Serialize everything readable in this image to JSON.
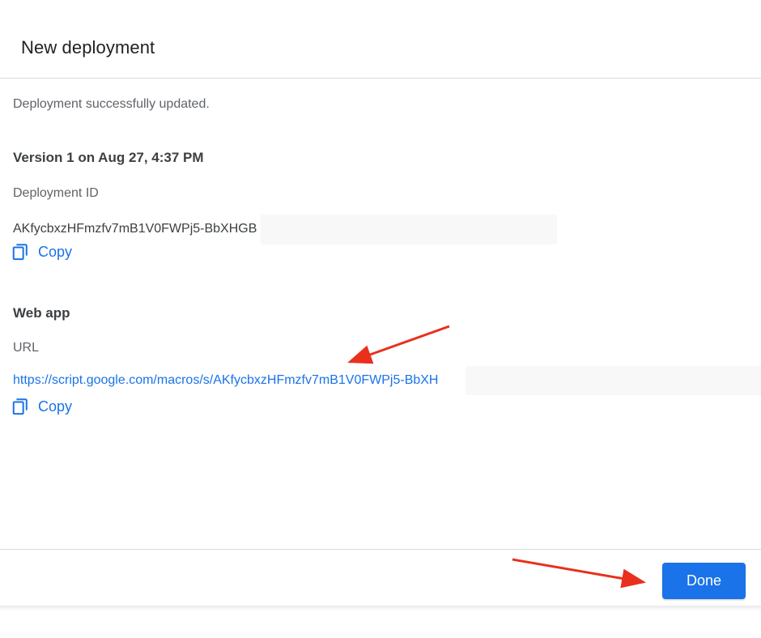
{
  "dialog": {
    "title": "New deployment",
    "status_message": "Deployment successfully updated."
  },
  "version": {
    "heading": "Version 1 on Aug 27, 4:37 PM"
  },
  "deployment_id": {
    "label": "Deployment ID",
    "value": "AKfycbxzHFmzfv7mB1V0FWPj5-BbXHGB",
    "copy_label": "Copy"
  },
  "web_app": {
    "heading": "Web app",
    "url_label": "URL",
    "url_value": "https://script.google.com/macros/s/AKfycbxzHFmzfv7mB1V0FWPj5-BbXH",
    "copy_label": "Copy"
  },
  "footer": {
    "done_label": "Done"
  },
  "colors": {
    "accent": "#1a73e8",
    "annotation_arrow": "#e8301c",
    "divider": "#dadce0"
  },
  "icons": {
    "copy": "copy-icon",
    "annotation": "arrow-annotation"
  }
}
